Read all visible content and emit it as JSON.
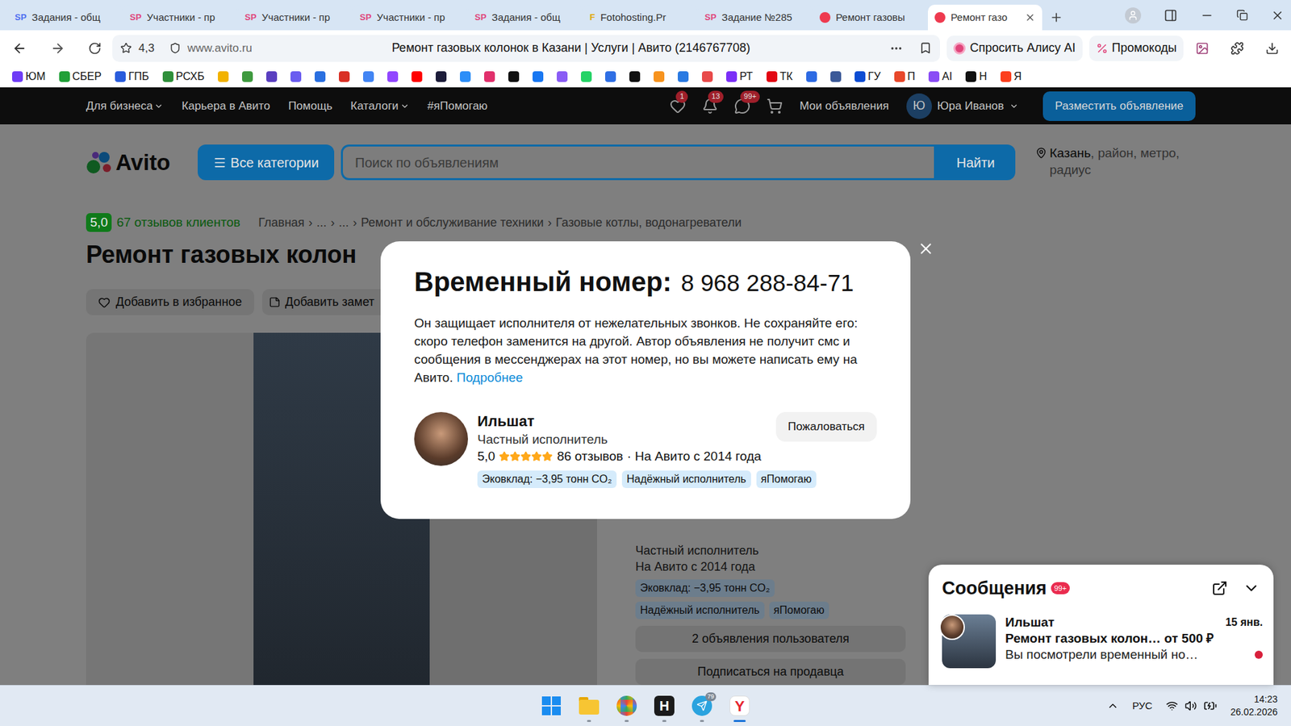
{
  "browser": {
    "tabs": [
      {
        "icon": "SP",
        "color": "#4f6ef0",
        "label": "Задания - общ",
        "selected": false
      },
      {
        "icon": "SP",
        "color": "#e0457b",
        "label": "Участники - пр",
        "selected": false
      },
      {
        "icon": "SP",
        "color": "#e0457b",
        "label": "Участники - пр",
        "selected": false
      },
      {
        "icon": "SP",
        "color": "#e0457b",
        "label": "Участники - пр",
        "selected": false
      },
      {
        "icon": "SP",
        "color": "#e0457b",
        "label": "Задания - общ",
        "selected": false
      },
      {
        "icon": "F",
        "color": "#e0a800",
        "label": "Fotohosting.Pr",
        "selected": false
      },
      {
        "icon": "SP",
        "color": "#e0457b",
        "label": "Задание №285",
        "selected": false
      },
      {
        "icon": "",
        "color": "#ee3a4f",
        "label": "Ремонт газовы",
        "selected": false
      },
      {
        "icon": "",
        "color": "#ee3a4f",
        "label": "Ремонт газо",
        "selected": true
      }
    ],
    "rating": "4,3",
    "url": "www.avito.ru",
    "page_title": "Ремонт газовых колонок в Казани | Услуги | Авито (2146767708)",
    "alice": "Спросить Алису AI",
    "promo": "Промокоды",
    "bookmarks": [
      {
        "label": "ЮМ",
        "color": "#6f3cf6"
      },
      {
        "label": "СБЕР",
        "color": "#21a038"
      },
      {
        "label": "ГПБ",
        "color": "#2a5cdc"
      },
      {
        "label": "РСХБ",
        "color": "#2f8f3a"
      },
      {
        "label": "",
        "color": "#f2b200"
      },
      {
        "label": "",
        "color": "#3f9a3f"
      },
      {
        "label": "",
        "color": "#5a3fc0"
      },
      {
        "label": "",
        "color": "#6a5cf0"
      },
      {
        "label": "",
        "color": "#2a6fe0"
      },
      {
        "label": "",
        "color": "#d93025"
      },
      {
        "label": "",
        "color": "#4285f4"
      },
      {
        "label": "",
        "color": "#9146ff"
      },
      {
        "label": "",
        "color": "#ff0000"
      },
      {
        "label": "",
        "color": "#1d1d3a"
      },
      {
        "label": "",
        "color": "#2c8ef8"
      },
      {
        "label": "",
        "color": "#e1306c"
      },
      {
        "label": "",
        "color": "#111111"
      },
      {
        "label": "",
        "color": "#1877f2"
      },
      {
        "label": "",
        "color": "#8a5cf5"
      },
      {
        "label": "",
        "color": "#25d366"
      },
      {
        "label": "",
        "color": "#2f6fe4"
      },
      {
        "label": "",
        "color": "#111111"
      },
      {
        "label": "",
        "color": "#f7931e"
      },
      {
        "label": "",
        "color": "#2a7ae2"
      },
      {
        "label": "",
        "color": "#e84a4a"
      },
      {
        "label": "РТ",
        "color": "#7b2ff7"
      },
      {
        "label": "ТК",
        "color": "#e30613"
      },
      {
        "label": "",
        "color": "#2d6ae3"
      },
      {
        "label": "",
        "color": "#3b5998"
      },
      {
        "label": "ГУ",
        "color": "#0d4cd3"
      },
      {
        "label": "П",
        "color": "#e8472a"
      },
      {
        "label": "AI",
        "color": "#8a4cf5"
      },
      {
        "label": "Н",
        "color": "#111111"
      },
      {
        "label": "Я",
        "color": "#fc3f1d"
      }
    ]
  },
  "header": {
    "nav": [
      {
        "label": "Для бизнеса",
        "dropdown": true
      },
      {
        "label": "Карьера в Авито",
        "dropdown": false
      },
      {
        "label": "Помощь",
        "dropdown": false
      },
      {
        "label": "Каталоги",
        "dropdown": true
      },
      {
        "label": "#яПомогаю",
        "dropdown": false
      }
    ],
    "icons": [
      {
        "kind": "favorites",
        "badge": "1"
      },
      {
        "kind": "notifications",
        "badge": "13"
      },
      {
        "kind": "messages",
        "badge": "99+"
      },
      {
        "kind": "cart",
        "badge": ""
      }
    ],
    "my_ads": "Мои объявления",
    "user_initial": "Ю",
    "user_name": "Юра Иванов",
    "post_button": "Разместить объявление"
  },
  "search": {
    "logo": "Avito",
    "categories": "Все категории",
    "placeholder": "Поиск по объявлениям",
    "button": "Найти",
    "location": "Казань",
    "location_hint": ", район, метро, радиус"
  },
  "listing": {
    "rating": "5,0",
    "reviews": "67 отзывов клиентов",
    "separator": "›",
    "breadcrumbs": [
      "Главная",
      "...",
      "...",
      "Ремонт и обслуживание техники",
      "Газовые котлы, водонагреватели"
    ],
    "title": "Ремонт газовых колон",
    "actions": [
      "Добавить в избранное",
      "Добавить замет"
    ],
    "seller_panel": {
      "type": "Частный исполнитель",
      "since": "На Авито с 2014 года",
      "tags": [
        "Эковклад: −3,95 тонн CO₂",
        "Надёжный исполнитель",
        "яПомогаю"
      ],
      "buttons": [
        "2 объявления пользователя",
        "Подписаться на продавца"
      ]
    }
  },
  "modal": {
    "title": "Временный номер:",
    "phone": "8 968 288-84-71",
    "text": "Он защищает исполнителя от нежелательных звонков. Не сохраняйте его: скоро телефон заменится на другой. Автор объявления не получит смс и сообщения в мессенджерах на этот номер, но вы можете написать ему на Авито. ",
    "link": "Подробнее",
    "seller": {
      "name": "Ильшат",
      "type": "Частный исполнитель",
      "rating": "5,0",
      "stars": 5,
      "reviews": "86 отзывов",
      "since": "· На Авито с 2014 года",
      "tags": [
        "Эковклад: −3,95 тонн CO₂",
        "Надёжный исполнитель",
        "яПомогаю"
      ]
    },
    "report": "Пожаловаться"
  },
  "messages": {
    "title": "Сообщения",
    "badge": "99+",
    "items": [
      {
        "name": "Ильшат",
        "date": "15 янв.",
        "subject": "Ремонт газовых колон… от 500 ₽",
        "preview": "Вы посмотрели временный но…",
        "unread": true
      }
    ]
  },
  "taskbar": {
    "apps": [
      {
        "kind": "start",
        "label": "",
        "badge": "",
        "running": false,
        "active": false
      },
      {
        "kind": "explorer",
        "label": "",
        "badge": "",
        "running": true,
        "active": false
      },
      {
        "kind": "browser",
        "label": "",
        "badge": "",
        "running": true,
        "active": false
      },
      {
        "kind": "h",
        "label": "H",
        "badge": "",
        "running": true,
        "active": false
      },
      {
        "kind": "telegram",
        "label": "",
        "badge": "79",
        "running": true,
        "active": false
      },
      {
        "kind": "yandex",
        "label": "Y",
        "badge": "",
        "running": true,
        "active": true
      }
    ],
    "language": "РУС",
    "time": "14:23",
    "date": "26.02.2026"
  }
}
